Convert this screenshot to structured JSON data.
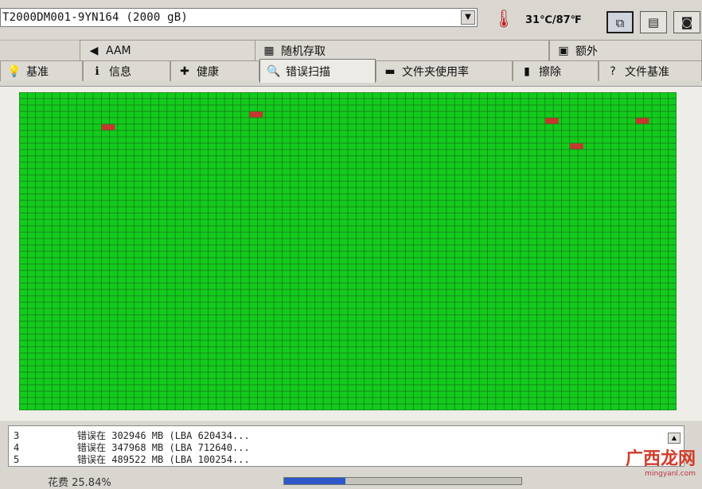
{
  "drive": {
    "name": "T2000DM001-9YN164  (2000 gB)"
  },
  "temperature": {
    "text": "31℃/87℉"
  },
  "toolbar": {
    "buttons": [
      {
        "name": "copy-report-button",
        "icon": "copy-icon",
        "glyph": "⧉",
        "active": true
      },
      {
        "name": "save-report-button",
        "icon": "save-icon",
        "glyph": "▤",
        "active": false
      },
      {
        "name": "screenshot-button",
        "icon": "camera-icon",
        "glyph": "◙",
        "active": false
      }
    ]
  },
  "tabs": {
    "row1": [
      {
        "label": "AAM",
        "icon": "speaker-icon",
        "glyph": "◀"
      },
      {
        "label": "随机存取",
        "icon": "random-access-icon",
        "glyph": "▦"
      },
      {
        "label": "额外",
        "icon": "extra-icon",
        "glyph": "▣"
      }
    ],
    "row2": [
      {
        "label": "基准",
        "icon": "lightbulb-icon",
        "glyph": "💡"
      },
      {
        "label": "信息",
        "icon": "info-icon",
        "glyph": "ℹ"
      },
      {
        "label": "健康",
        "icon": "health-cross-icon",
        "glyph": "✚"
      },
      {
        "label": "错误扫描",
        "icon": "magnifier-icon",
        "glyph": "🔍",
        "selected": true
      },
      {
        "label": "文件夹使用率",
        "icon": "folder-icon",
        "glyph": "▬"
      },
      {
        "label": "擦除",
        "icon": "trash-icon",
        "glyph": "▮"
      },
      {
        "label": "文件基准",
        "icon": "file-benchmark-icon",
        "glyph": "?"
      }
    ]
  },
  "scan": {
    "cols": 80,
    "rows": 50,
    "colors": {
      "ok": "#12cc1c",
      "error": "#c8372d",
      "grid": "#1e6f1e"
    },
    "error_blocks": [
      {
        "row": 5,
        "col": 10
      },
      {
        "row": 3,
        "col": 28
      },
      {
        "row": 4,
        "col": 64
      },
      {
        "row": 4,
        "col": 75
      },
      {
        "row": 8,
        "col": 67
      }
    ]
  },
  "log": {
    "entries": [
      {
        "num": "3",
        "text": "错误在 302946 MB (LBA 620434..."
      },
      {
        "num": "4",
        "text": "错误在 347968 MB (LBA 712640..."
      },
      {
        "num": "5",
        "text": "错误在 489522 MB (LBA 100254..."
      }
    ]
  },
  "status": {
    "text": "花费  25.84%",
    "progress_fraction": 0.26
  },
  "watermark": {
    "text": "广西龙网",
    "url": "mingyanl.com"
  }
}
